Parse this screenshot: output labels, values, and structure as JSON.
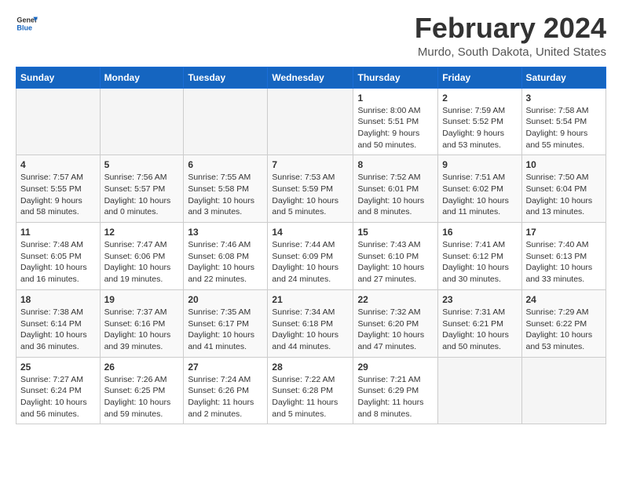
{
  "header": {
    "logo_general": "General",
    "logo_blue": "Blue",
    "title": "February 2024",
    "subtitle": "Murdo, South Dakota, United States"
  },
  "days_of_week": [
    "Sunday",
    "Monday",
    "Tuesday",
    "Wednesday",
    "Thursday",
    "Friday",
    "Saturday"
  ],
  "weeks": [
    [
      {
        "num": "",
        "info": ""
      },
      {
        "num": "",
        "info": ""
      },
      {
        "num": "",
        "info": ""
      },
      {
        "num": "",
        "info": ""
      },
      {
        "num": "1",
        "info": "Sunrise: 8:00 AM\nSunset: 5:51 PM\nDaylight: 9 hours\nand 50 minutes."
      },
      {
        "num": "2",
        "info": "Sunrise: 7:59 AM\nSunset: 5:52 PM\nDaylight: 9 hours\nand 53 minutes."
      },
      {
        "num": "3",
        "info": "Sunrise: 7:58 AM\nSunset: 5:54 PM\nDaylight: 9 hours\nand 55 minutes."
      }
    ],
    [
      {
        "num": "4",
        "info": "Sunrise: 7:57 AM\nSunset: 5:55 PM\nDaylight: 9 hours\nand 58 minutes."
      },
      {
        "num": "5",
        "info": "Sunrise: 7:56 AM\nSunset: 5:57 PM\nDaylight: 10 hours\nand 0 minutes."
      },
      {
        "num": "6",
        "info": "Sunrise: 7:55 AM\nSunset: 5:58 PM\nDaylight: 10 hours\nand 3 minutes."
      },
      {
        "num": "7",
        "info": "Sunrise: 7:53 AM\nSunset: 5:59 PM\nDaylight: 10 hours\nand 5 minutes."
      },
      {
        "num": "8",
        "info": "Sunrise: 7:52 AM\nSunset: 6:01 PM\nDaylight: 10 hours\nand 8 minutes."
      },
      {
        "num": "9",
        "info": "Sunrise: 7:51 AM\nSunset: 6:02 PM\nDaylight: 10 hours\nand 11 minutes."
      },
      {
        "num": "10",
        "info": "Sunrise: 7:50 AM\nSunset: 6:04 PM\nDaylight: 10 hours\nand 13 minutes."
      }
    ],
    [
      {
        "num": "11",
        "info": "Sunrise: 7:48 AM\nSunset: 6:05 PM\nDaylight: 10 hours\nand 16 minutes."
      },
      {
        "num": "12",
        "info": "Sunrise: 7:47 AM\nSunset: 6:06 PM\nDaylight: 10 hours\nand 19 minutes."
      },
      {
        "num": "13",
        "info": "Sunrise: 7:46 AM\nSunset: 6:08 PM\nDaylight: 10 hours\nand 22 minutes."
      },
      {
        "num": "14",
        "info": "Sunrise: 7:44 AM\nSunset: 6:09 PM\nDaylight: 10 hours\nand 24 minutes."
      },
      {
        "num": "15",
        "info": "Sunrise: 7:43 AM\nSunset: 6:10 PM\nDaylight: 10 hours\nand 27 minutes."
      },
      {
        "num": "16",
        "info": "Sunrise: 7:41 AM\nSunset: 6:12 PM\nDaylight: 10 hours\nand 30 minutes."
      },
      {
        "num": "17",
        "info": "Sunrise: 7:40 AM\nSunset: 6:13 PM\nDaylight: 10 hours\nand 33 minutes."
      }
    ],
    [
      {
        "num": "18",
        "info": "Sunrise: 7:38 AM\nSunset: 6:14 PM\nDaylight: 10 hours\nand 36 minutes."
      },
      {
        "num": "19",
        "info": "Sunrise: 7:37 AM\nSunset: 6:16 PM\nDaylight: 10 hours\nand 39 minutes."
      },
      {
        "num": "20",
        "info": "Sunrise: 7:35 AM\nSunset: 6:17 PM\nDaylight: 10 hours\nand 41 minutes."
      },
      {
        "num": "21",
        "info": "Sunrise: 7:34 AM\nSunset: 6:18 PM\nDaylight: 10 hours\nand 44 minutes."
      },
      {
        "num": "22",
        "info": "Sunrise: 7:32 AM\nSunset: 6:20 PM\nDaylight: 10 hours\nand 47 minutes."
      },
      {
        "num": "23",
        "info": "Sunrise: 7:31 AM\nSunset: 6:21 PM\nDaylight: 10 hours\nand 50 minutes."
      },
      {
        "num": "24",
        "info": "Sunrise: 7:29 AM\nSunset: 6:22 PM\nDaylight: 10 hours\nand 53 minutes."
      }
    ],
    [
      {
        "num": "25",
        "info": "Sunrise: 7:27 AM\nSunset: 6:24 PM\nDaylight: 10 hours\nand 56 minutes."
      },
      {
        "num": "26",
        "info": "Sunrise: 7:26 AM\nSunset: 6:25 PM\nDaylight: 10 hours\nand 59 minutes."
      },
      {
        "num": "27",
        "info": "Sunrise: 7:24 AM\nSunset: 6:26 PM\nDaylight: 11 hours\nand 2 minutes."
      },
      {
        "num": "28",
        "info": "Sunrise: 7:22 AM\nSunset: 6:28 PM\nDaylight: 11 hours\nand 5 minutes."
      },
      {
        "num": "29",
        "info": "Sunrise: 7:21 AM\nSunset: 6:29 PM\nDaylight: 11 hours\nand 8 minutes."
      },
      {
        "num": "",
        "info": ""
      },
      {
        "num": "",
        "info": ""
      }
    ]
  ]
}
